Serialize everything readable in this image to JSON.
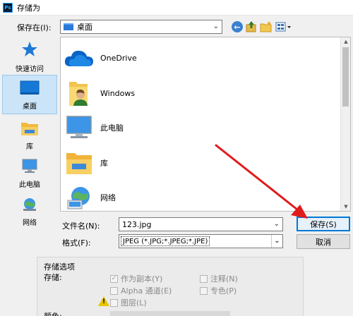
{
  "window": {
    "app_badge": "Ps",
    "title": "存储为"
  },
  "location": {
    "label": "保存在(I):",
    "value": "桌面"
  },
  "toolbar": {
    "back_icon": "back-arrow-icon",
    "up_icon": "up-folder-icon",
    "new_folder_icon": "new-folder-icon",
    "view_icon": "view-menu-icon"
  },
  "places": [
    {
      "label": "快速访问",
      "icon": "star-icon"
    },
    {
      "label": "桌面",
      "icon": "desktop-icon"
    },
    {
      "label": "库",
      "icon": "library-icon"
    },
    {
      "label": "此电脑",
      "icon": "computer-icon"
    },
    {
      "label": "网络",
      "icon": "network-icon"
    }
  ],
  "files": [
    {
      "name": "OneDrive",
      "icon": "onedrive-cloud-icon"
    },
    {
      "name": "Windows",
      "icon": "user-folder-icon"
    },
    {
      "name": "此电脑",
      "icon": "computer-icon"
    },
    {
      "name": "库",
      "icon": "library-folder-icon"
    },
    {
      "name": "网络",
      "icon": "network-globe-icon"
    }
  ],
  "filename": {
    "label": "文件名(N):",
    "value": "123.jpg"
  },
  "format": {
    "label": "格式(F):",
    "value": "JPEG (*.JPG;*.JPEG;*.JPE)"
  },
  "buttons": {
    "save": "保存(S)",
    "cancel": "取消"
  },
  "save_options": {
    "section_title": "存储选项",
    "store_label": "存储:",
    "as_copy": "作为副本(Y)",
    "notes": "注释(N)",
    "alpha": "Alpha 通道(E)",
    "spot": "专色(P)",
    "layers": "图层(L)",
    "color_label": "颜色:"
  }
}
